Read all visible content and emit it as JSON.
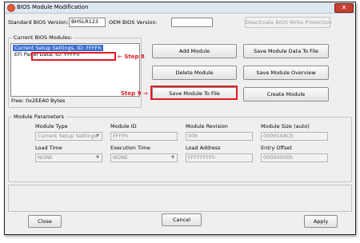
{
  "window": {
    "title": "BIOS Module Modification",
    "close_glyph": "✕"
  },
  "header": {
    "standard_bios_label": "Standard BIOS Version:",
    "standard_bios_value": "BHSLR123",
    "oem_bios_label": "OEM BIOS Version:",
    "oem_bios_value": "",
    "deactivate_label": "Deactivate BIOS Write Protection"
  },
  "modules": {
    "group_label": "Current BIOS Modules:",
    "items": [
      "Current Setup Settings, ID: FFFFh",
      "EFI Panel Data, ID: FFFFh"
    ],
    "free_label": "Free: 0x2EEA0 Bytes"
  },
  "buttons": {
    "add_module": "Add Module",
    "save_module_data": "Save Module Data To File",
    "delete_module": "Delete Module",
    "save_module_overview": "Save Module Overview",
    "save_module_to_file": "Save Module To File",
    "create_module": "Create Module",
    "close": "Close",
    "cancel": "Cancel",
    "apply": "Apply"
  },
  "annotations": {
    "step8": "Step 8",
    "step9": "Step 9"
  },
  "params": {
    "group_label": "Module Parameters",
    "module_type_label": "Module Type",
    "module_type_value": "Current Setup Settings",
    "module_id_label": "Module ID",
    "module_id_value": "FFFFh",
    "module_revision_label": "Module Revision",
    "module_revision_value": "00h",
    "module_size_label": "Module Size (auto)",
    "module_size_value": "000010ACh",
    "load_time_label": "Load Time",
    "load_time_value": "NONE",
    "execution_time_label": "Execution Time",
    "execution_time_value": "NONE",
    "load_address_label": "Load Address",
    "load_address_value": "FFFFFFFFh",
    "entry_offset_label": "Entry Offset",
    "entry_offset_value": "00000000h"
  },
  "colors": {
    "highlight": "#e01c24",
    "selection": "#3a6fd0"
  }
}
